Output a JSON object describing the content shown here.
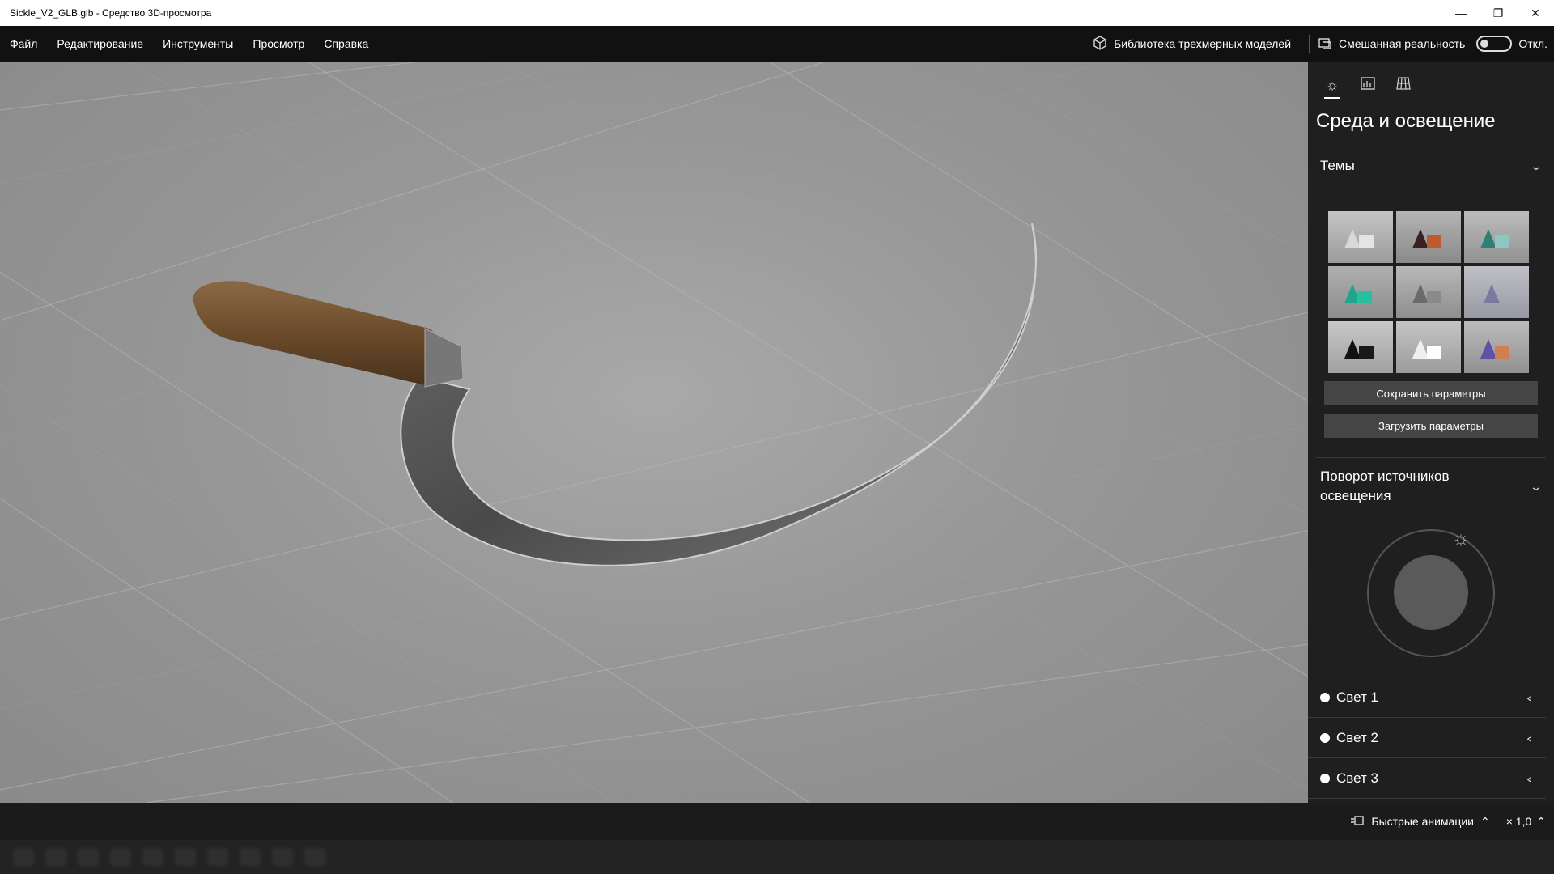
{
  "window": {
    "title": "Sickle_V2_GLB.glb - Средство 3D-просмотра"
  },
  "menu": {
    "items": [
      "Файл",
      "Редактирование",
      "Инструменты",
      "Просмотр",
      "Справка"
    ],
    "library_label": "Библиотека трехмерных моделей",
    "mixed_reality_label": "Смешанная реальность",
    "mixed_reality_state": "Откл."
  },
  "panel": {
    "tabs": [
      "sun-icon",
      "stats-icon",
      "grid-icon"
    ],
    "title": "Среда и освещение",
    "themes_label": "Темы",
    "save_label": "Сохранить параметры",
    "load_label": "Загрузить параметры",
    "rotation_label": "Поворот источников освещения",
    "lights": [
      "Свет 1",
      "Свет 2",
      "Свет 3"
    ]
  },
  "status": {
    "animations_label": "Быстрые анимации",
    "speed": "× 1,0"
  },
  "colors": {
    "titlebar": "#ffffff",
    "menubar": "#111111",
    "panel": "#1f1f1f",
    "button": "#454545",
    "viewport_floor": "#999999"
  }
}
